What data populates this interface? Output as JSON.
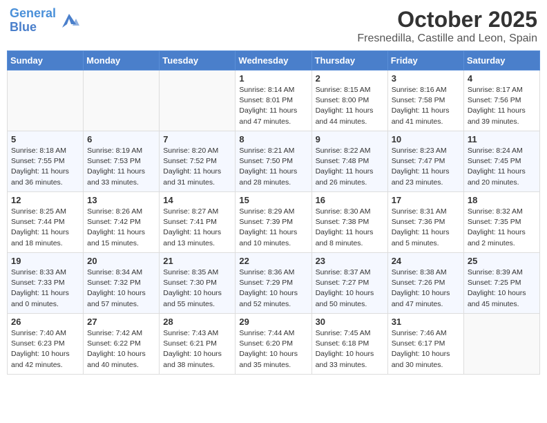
{
  "logo": {
    "line1": "General",
    "line2": "Blue"
  },
  "title": "October 2025",
  "location": "Fresnedilla, Castille and Leon, Spain",
  "weekdays": [
    "Sunday",
    "Monday",
    "Tuesday",
    "Wednesday",
    "Thursday",
    "Friday",
    "Saturday"
  ],
  "weeks": [
    [
      {
        "day": "",
        "info": ""
      },
      {
        "day": "",
        "info": ""
      },
      {
        "day": "",
        "info": ""
      },
      {
        "day": "1",
        "info": "Sunrise: 8:14 AM\nSunset: 8:01 PM\nDaylight: 11 hours\nand 47 minutes."
      },
      {
        "day": "2",
        "info": "Sunrise: 8:15 AM\nSunset: 8:00 PM\nDaylight: 11 hours\nand 44 minutes."
      },
      {
        "day": "3",
        "info": "Sunrise: 8:16 AM\nSunset: 7:58 PM\nDaylight: 11 hours\nand 41 minutes."
      },
      {
        "day": "4",
        "info": "Sunrise: 8:17 AM\nSunset: 7:56 PM\nDaylight: 11 hours\nand 39 minutes."
      }
    ],
    [
      {
        "day": "5",
        "info": "Sunrise: 8:18 AM\nSunset: 7:55 PM\nDaylight: 11 hours\nand 36 minutes."
      },
      {
        "day": "6",
        "info": "Sunrise: 8:19 AM\nSunset: 7:53 PM\nDaylight: 11 hours\nand 33 minutes."
      },
      {
        "day": "7",
        "info": "Sunrise: 8:20 AM\nSunset: 7:52 PM\nDaylight: 11 hours\nand 31 minutes."
      },
      {
        "day": "8",
        "info": "Sunrise: 8:21 AM\nSunset: 7:50 PM\nDaylight: 11 hours\nand 28 minutes."
      },
      {
        "day": "9",
        "info": "Sunrise: 8:22 AM\nSunset: 7:48 PM\nDaylight: 11 hours\nand 26 minutes."
      },
      {
        "day": "10",
        "info": "Sunrise: 8:23 AM\nSunset: 7:47 PM\nDaylight: 11 hours\nand 23 minutes."
      },
      {
        "day": "11",
        "info": "Sunrise: 8:24 AM\nSunset: 7:45 PM\nDaylight: 11 hours\nand 20 minutes."
      }
    ],
    [
      {
        "day": "12",
        "info": "Sunrise: 8:25 AM\nSunset: 7:44 PM\nDaylight: 11 hours\nand 18 minutes."
      },
      {
        "day": "13",
        "info": "Sunrise: 8:26 AM\nSunset: 7:42 PM\nDaylight: 11 hours\nand 15 minutes."
      },
      {
        "day": "14",
        "info": "Sunrise: 8:27 AM\nSunset: 7:41 PM\nDaylight: 11 hours\nand 13 minutes."
      },
      {
        "day": "15",
        "info": "Sunrise: 8:29 AM\nSunset: 7:39 PM\nDaylight: 11 hours\nand 10 minutes."
      },
      {
        "day": "16",
        "info": "Sunrise: 8:30 AM\nSunset: 7:38 PM\nDaylight: 11 hours\nand 8 minutes."
      },
      {
        "day": "17",
        "info": "Sunrise: 8:31 AM\nSunset: 7:36 PM\nDaylight: 11 hours\nand 5 minutes."
      },
      {
        "day": "18",
        "info": "Sunrise: 8:32 AM\nSunset: 7:35 PM\nDaylight: 11 hours\nand 2 minutes."
      }
    ],
    [
      {
        "day": "19",
        "info": "Sunrise: 8:33 AM\nSunset: 7:33 PM\nDaylight: 11 hours\nand 0 minutes."
      },
      {
        "day": "20",
        "info": "Sunrise: 8:34 AM\nSunset: 7:32 PM\nDaylight: 10 hours\nand 57 minutes."
      },
      {
        "day": "21",
        "info": "Sunrise: 8:35 AM\nSunset: 7:30 PM\nDaylight: 10 hours\nand 55 minutes."
      },
      {
        "day": "22",
        "info": "Sunrise: 8:36 AM\nSunset: 7:29 PM\nDaylight: 10 hours\nand 52 minutes."
      },
      {
        "day": "23",
        "info": "Sunrise: 8:37 AM\nSunset: 7:27 PM\nDaylight: 10 hours\nand 50 minutes."
      },
      {
        "day": "24",
        "info": "Sunrise: 8:38 AM\nSunset: 7:26 PM\nDaylight: 10 hours\nand 47 minutes."
      },
      {
        "day": "25",
        "info": "Sunrise: 8:39 AM\nSunset: 7:25 PM\nDaylight: 10 hours\nand 45 minutes."
      }
    ],
    [
      {
        "day": "26",
        "info": "Sunrise: 7:40 AM\nSunset: 6:23 PM\nDaylight: 10 hours\nand 42 minutes."
      },
      {
        "day": "27",
        "info": "Sunrise: 7:42 AM\nSunset: 6:22 PM\nDaylight: 10 hours\nand 40 minutes."
      },
      {
        "day": "28",
        "info": "Sunrise: 7:43 AM\nSunset: 6:21 PM\nDaylight: 10 hours\nand 38 minutes."
      },
      {
        "day": "29",
        "info": "Sunrise: 7:44 AM\nSunset: 6:20 PM\nDaylight: 10 hours\nand 35 minutes."
      },
      {
        "day": "30",
        "info": "Sunrise: 7:45 AM\nSunset: 6:18 PM\nDaylight: 10 hours\nand 33 minutes."
      },
      {
        "day": "31",
        "info": "Sunrise: 7:46 AM\nSunset: 6:17 PM\nDaylight: 10 hours\nand 30 minutes."
      },
      {
        "day": "",
        "info": ""
      }
    ]
  ]
}
